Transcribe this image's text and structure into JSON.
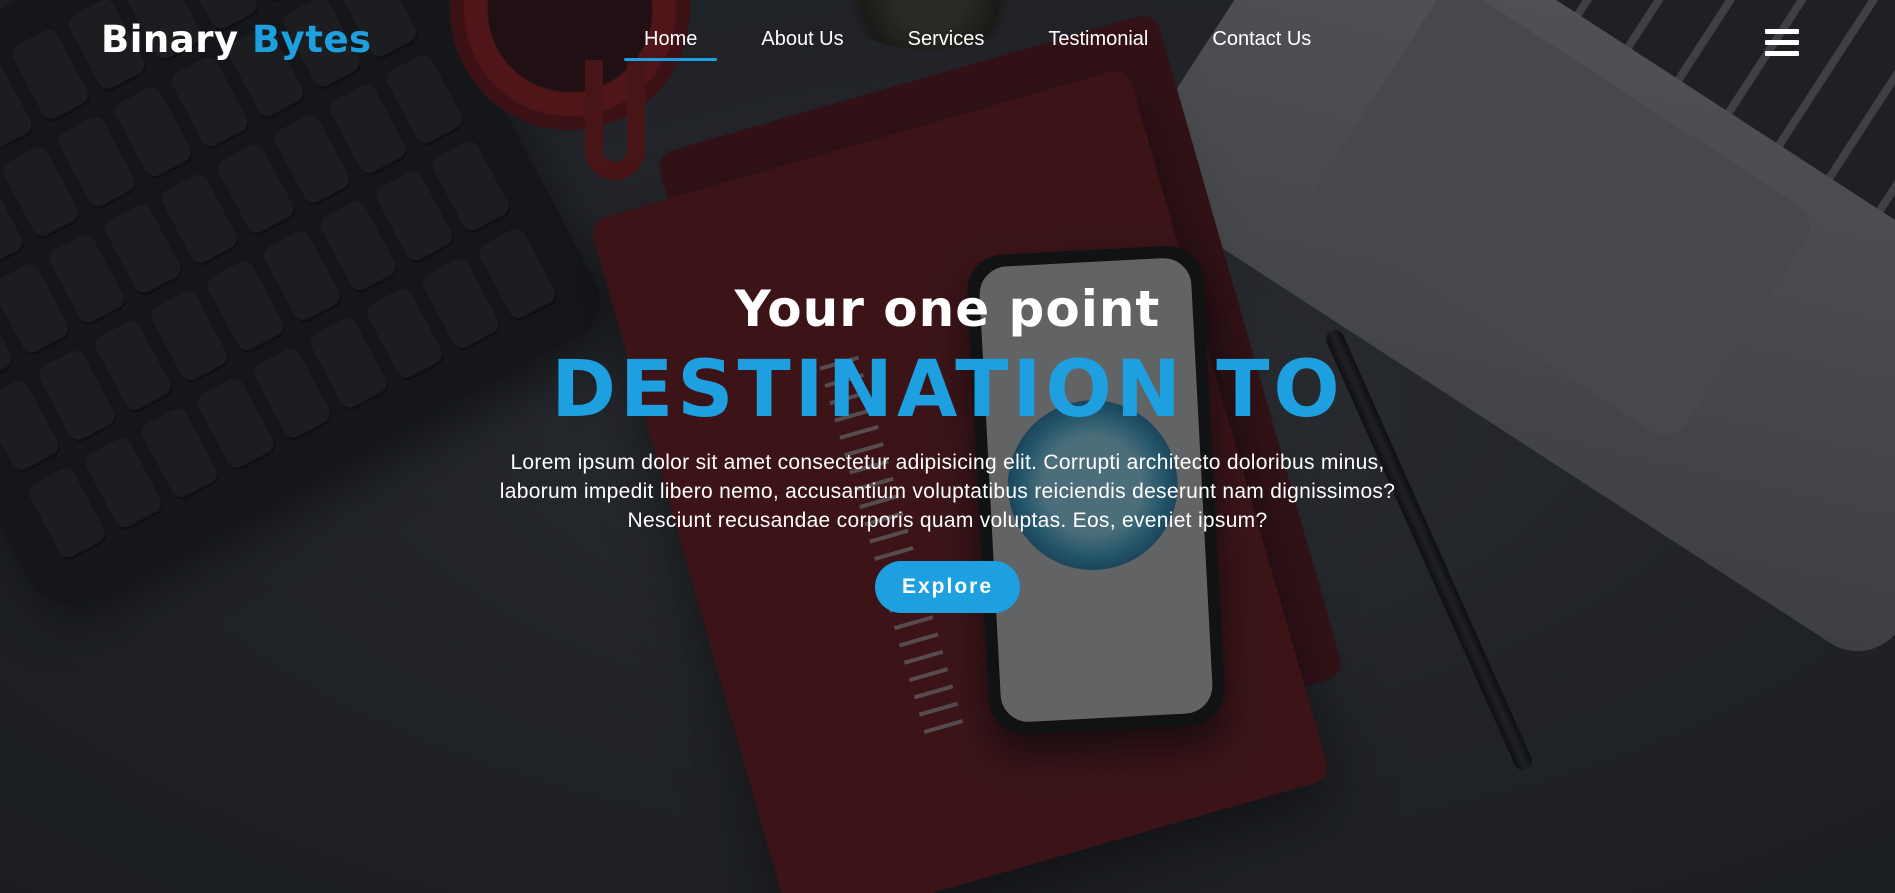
{
  "brand": {
    "name_primary": "Binary",
    "name_accent": "Bytes"
  },
  "nav": {
    "items": [
      {
        "label": "Home",
        "active": true
      },
      {
        "label": "About Us"
      },
      {
        "label": "Services"
      },
      {
        "label": "Testimonial"
      },
      {
        "label": "Contact Us"
      }
    ],
    "menu_icon": "hamburger-menu-icon"
  },
  "hero": {
    "subtitle": "Your one point",
    "headline": "DESTINATION TO",
    "description": "Lorem ipsum dolor sit amet consectetur adipisicing elit. Corrupti architecto doloribus minus, laborum impedit libero nemo, accusantium voluptatibus reiciendis deserunt nam dignissimos? Nesciunt recusandae corporis quam voluptas. Eos, eveniet ipsum?",
    "button_label": "Explore"
  },
  "colors": {
    "accent": "#1ea0e0",
    "text": "#ffffff",
    "background": "#2b2e33"
  }
}
